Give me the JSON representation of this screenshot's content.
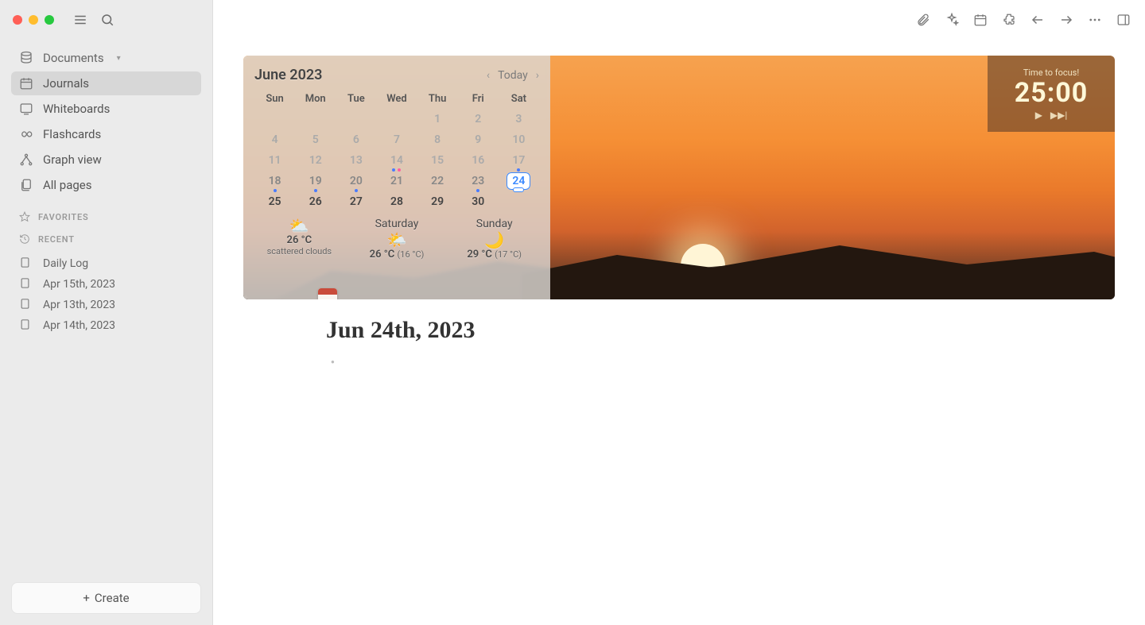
{
  "sidebar": {
    "documents": "Documents",
    "journals": "Journals",
    "whiteboards": "Whiteboards",
    "flashcards": "Flashcards",
    "graph": "Graph view",
    "allpages": "All pages",
    "favorites_header": "FAVORITES",
    "recent_header": "RECENT",
    "recent": [
      "Daily Log",
      "Apr 15th, 2023",
      "Apr 13th, 2023",
      "Apr 14th, 2023"
    ],
    "create": "Create"
  },
  "calendar": {
    "title": "June 2023",
    "today": "Today",
    "dow": [
      "Sun",
      "Mon",
      "Tue",
      "Wed",
      "Thu",
      "Fri",
      "Sat"
    ],
    "days": [
      "",
      "",
      "",
      "",
      "1",
      "2",
      "3",
      "4",
      "5",
      "6",
      "7",
      "8",
      "9",
      "10",
      "11",
      "12",
      "13",
      "14",
      "15",
      "16",
      "17",
      "18",
      "19",
      "20",
      "21",
      "22",
      "23",
      "24",
      "25",
      "26",
      "27",
      "28",
      "29",
      "30"
    ],
    "selected": "24",
    "pill_day": "17"
  },
  "weather": {
    "today_temp": "26 °C",
    "today_desc": "scattered clouds",
    "sat_label": "Saturday",
    "sat_temp": "26 °C",
    "sat_low": "16 °C",
    "sun_label": "Sunday",
    "sun_temp": "29 °C",
    "sun_low": "17 °C"
  },
  "pomodoro": {
    "label": "Time to focus!",
    "time": "25:00"
  },
  "page": {
    "title": "Jun 24th, 2023"
  }
}
